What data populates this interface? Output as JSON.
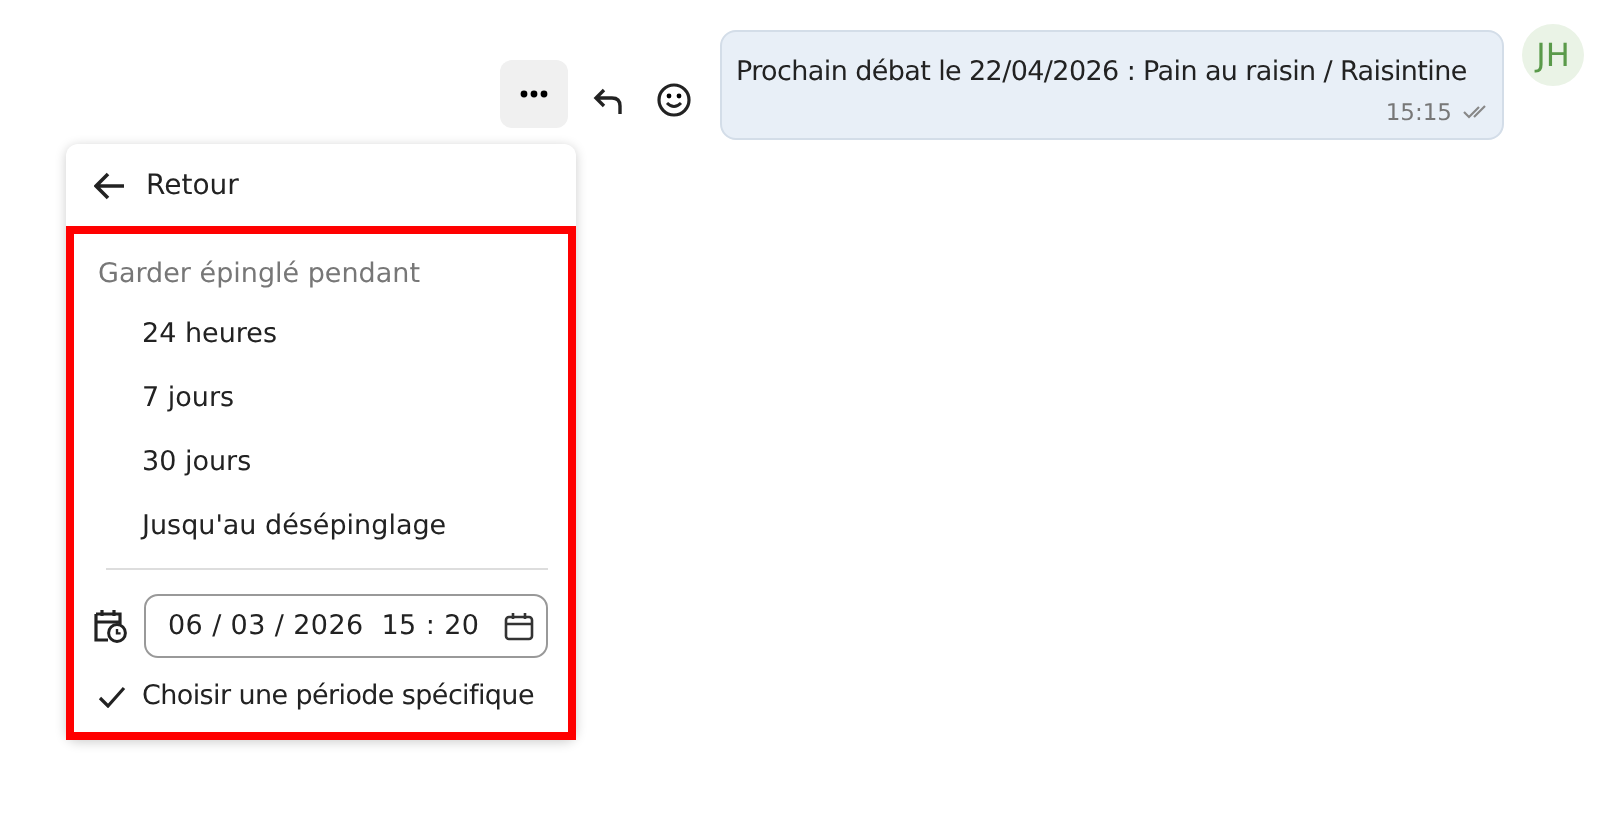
{
  "message": {
    "text": "Prochain débat le 22/04/2026 : Pain au raisin / Raisintine",
    "time": "15:15",
    "avatar": "JH"
  },
  "menu": {
    "back": "Retour",
    "heading": "Garder épinglé pendant",
    "options": [
      "24 heures",
      "7 jours",
      "30 jours",
      "Jusqu'au désépinglage"
    ],
    "date_field": {
      "value": "06 / 03 / 2026  15 : 20"
    },
    "custom": {
      "label": "Choisir une période spécifique",
      "checked": true
    }
  }
}
